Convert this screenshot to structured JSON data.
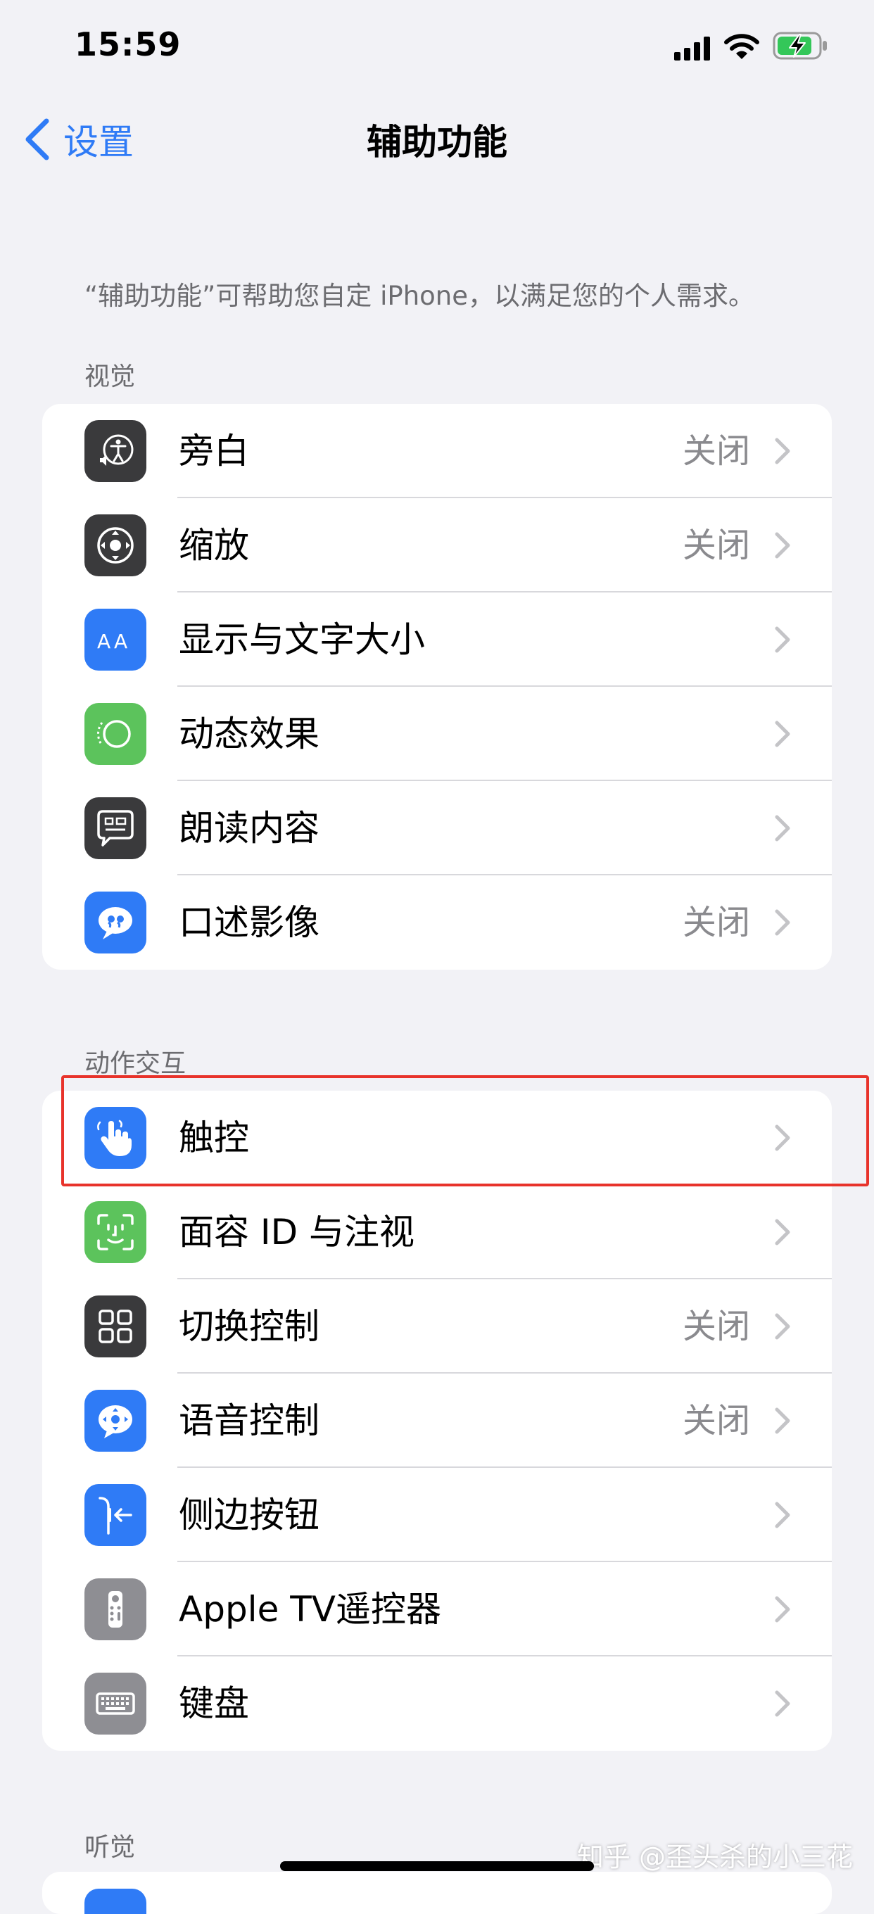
{
  "status_bar": {
    "time": "15:59",
    "icons": [
      "cellular-signal-icon",
      "wifi-icon",
      "battery-charging-icon"
    ]
  },
  "nav": {
    "back_label": "设置",
    "title": "辅助功能",
    "accent_color": "#2f7bf6"
  },
  "intro": "“辅助功能”可帮助您自定 iPhone，以满足您的个人需求。",
  "sections": {
    "vision": {
      "header": "视觉",
      "items": [
        {
          "label": "旁白",
          "value": "关闭",
          "icon": "voiceover-icon"
        },
        {
          "label": "缩放",
          "value": "关闭",
          "icon": "zoom-icon"
        },
        {
          "label": "显示与文字大小",
          "value": "",
          "icon": "text-size-icon"
        },
        {
          "label": "动态效果",
          "value": "",
          "icon": "motion-icon"
        },
        {
          "label": "朗读内容",
          "value": "",
          "icon": "spoken-content-icon"
        },
        {
          "label": "口述影像",
          "value": "关闭",
          "icon": "audio-description-icon"
        }
      ]
    },
    "interaction": {
      "header": "动作交互",
      "items": [
        {
          "label": "触控",
          "value": "",
          "icon": "touch-icon"
        },
        {
          "label": "面容 ID 与注视",
          "value": "",
          "icon": "face-id-icon"
        },
        {
          "label": "切换控制",
          "value": "关闭",
          "icon": "switch-control-icon"
        },
        {
          "label": "语音控制",
          "value": "关闭",
          "icon": "voice-control-icon"
        },
        {
          "label": "侧边按钮",
          "value": "",
          "icon": "side-button-icon"
        },
        {
          "label": "Apple TV遥控器",
          "value": "",
          "icon": "apple-tv-remote-icon"
        },
        {
          "label": "键盘",
          "value": "",
          "icon": "keyboard-icon"
        }
      ]
    },
    "hearing": {
      "header": "听觉"
    }
  },
  "watermark": "知乎 @歪头杀的小三花"
}
